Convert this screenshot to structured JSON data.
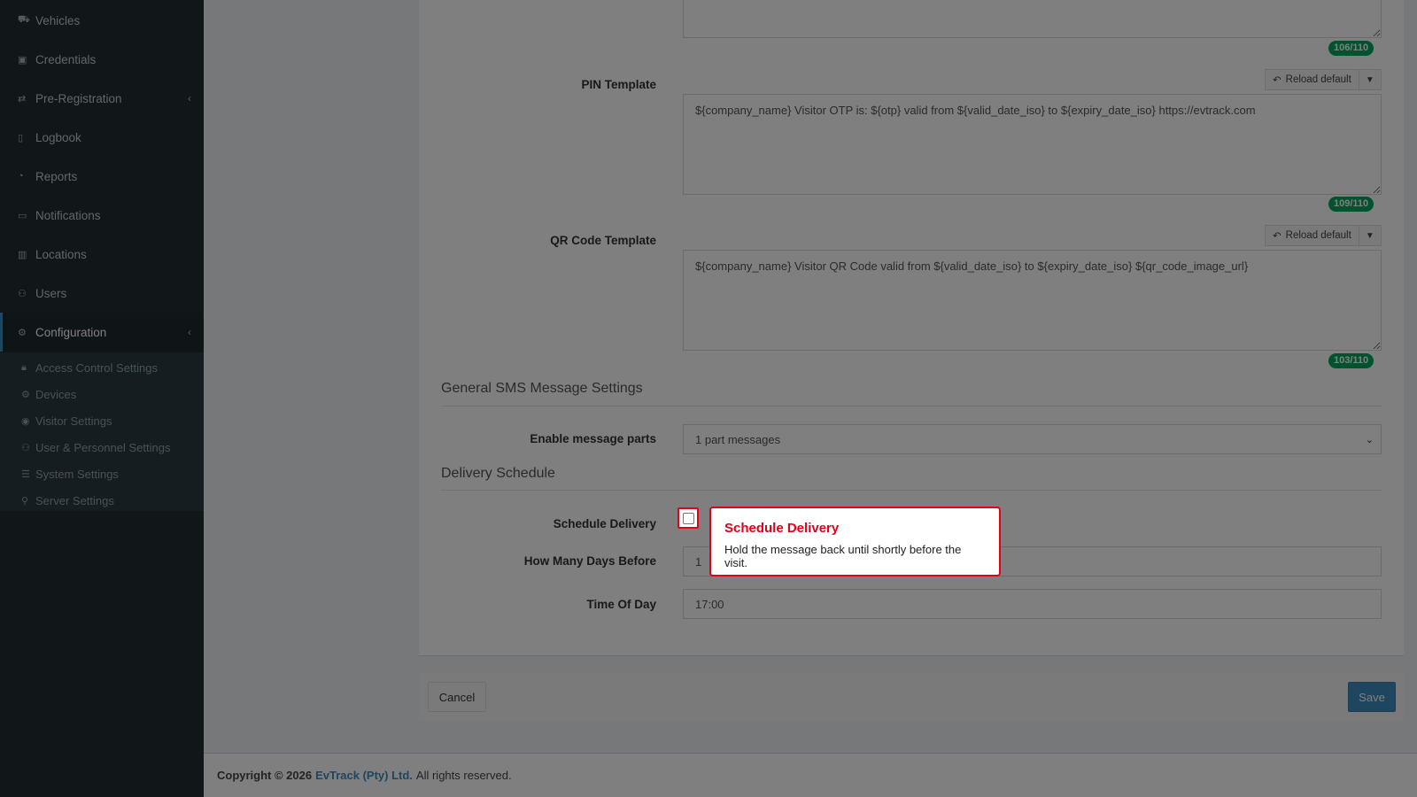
{
  "sidebar": {
    "items": [
      {
        "label": "Vehicles",
        "icon": "car-icon"
      },
      {
        "label": "Credentials",
        "icon": "id-card-icon"
      },
      {
        "label": "Pre-Registration",
        "icon": "exchange-icon"
      },
      {
        "label": "Logbook",
        "icon": "book-icon"
      },
      {
        "label": "Reports",
        "icon": "chart-icon"
      },
      {
        "label": "Notifications",
        "icon": "chat-icon"
      },
      {
        "label": "Locations",
        "icon": "building-icon"
      },
      {
        "label": "Users",
        "icon": "users-icon"
      },
      {
        "label": "Configuration",
        "icon": "gear-icon"
      }
    ],
    "subitems": [
      {
        "label": "Access Control Settings",
        "icon": "lock-icon"
      },
      {
        "label": "Devices",
        "icon": "cog-icon"
      },
      {
        "label": "Visitor Settings",
        "icon": "eye-icon"
      },
      {
        "label": "User & Personnel Settings",
        "icon": "user-cog-icon"
      },
      {
        "label": "System Settings",
        "icon": "sliders-icon"
      },
      {
        "label": "Server Settings",
        "icon": "server-icon"
      }
    ]
  },
  "form": {
    "top_counter": "106/110",
    "pin": {
      "label": "PIN Template",
      "reload": "Reload default",
      "value": "${company_name} Visitor OTP is: ${otp} valid from ${valid_date_iso} to ${expiry_date_iso} https://evtrack.com",
      "counter": "109/110"
    },
    "qr": {
      "label": "QR Code Template",
      "reload": "Reload default",
      "value": "${company_name} Visitor QR Code valid from ${valid_date_iso} to ${expiry_date_iso} ${qr_code_image_url}",
      "counter": "103/110"
    },
    "general_title": "General SMS Message Settings",
    "message_parts": {
      "label": "Enable message parts",
      "value": "1 part messages"
    },
    "delivery_title": "Delivery Schedule",
    "schedule": {
      "label": "Schedule Delivery"
    },
    "days_before": {
      "label": "How Many Days Before",
      "value": "1"
    },
    "time_of_day": {
      "label": "Time Of Day",
      "value": "17:00"
    }
  },
  "buttons": {
    "cancel": "Cancel",
    "save": "Save"
  },
  "footer": {
    "copyright": "Copyright © 2026",
    "company": "EvTrack (Pty) Ltd.",
    "rights": "All rights reserved."
  },
  "tooltip": {
    "title": "Schedule Delivery",
    "body": "Hold the message back until shortly before the visit."
  },
  "colors": {
    "highlight": "#e3001b",
    "accent": "#3c8dbc",
    "counter": "#00a65a",
    "sidebar": "#222d32"
  }
}
